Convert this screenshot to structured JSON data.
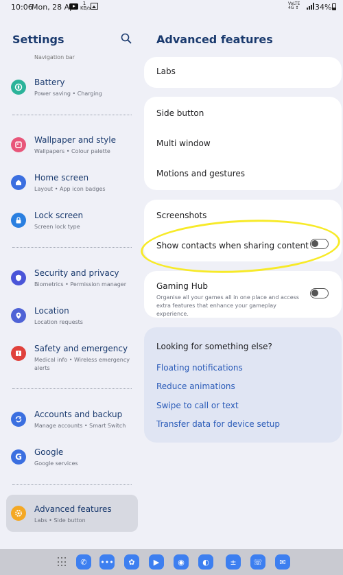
{
  "status_bar": {
    "time": "10:06",
    "date": "Mon, 28 Apr",
    "net_speed": "1\nKB/s",
    "network_label": "VoLTE 4G",
    "battery": "34%"
  },
  "left_panel": {
    "title": "Settings",
    "partial_item_subtitle": "Navigation bar",
    "items": [
      {
        "title": "Battery",
        "subtitle": "Power saving  •  Charging",
        "icon": "battery-icon",
        "color": "#2bb39a"
      },
      {
        "title": "Wallpaper and style",
        "subtitle": "Wallpapers  •  Colour palette",
        "icon": "wallpaper-icon",
        "color": "#e8567a"
      },
      {
        "title": "Home screen",
        "subtitle": "Layout  •  App icon badges",
        "icon": "home-icon",
        "color": "#3b6fe0"
      },
      {
        "title": "Lock screen",
        "subtitle": "Screen lock type",
        "icon": "lock-icon",
        "color": "#2a7fe0"
      },
      {
        "title": "Security and privacy",
        "subtitle": "Biometrics  •  Permission manager",
        "icon": "shield-icon",
        "color": "#4a55d8"
      },
      {
        "title": "Location",
        "subtitle": "Location requests",
        "icon": "location-icon",
        "color": "#4f63d6"
      },
      {
        "title": "Safety and emergency",
        "subtitle": "Medical info  •  Wireless emergency alerts",
        "icon": "emergency-icon",
        "color": "#e0413c"
      },
      {
        "title": "Accounts and backup",
        "subtitle": "Manage accounts  •  Smart Switch",
        "icon": "sync-icon",
        "color": "#3b6fe0"
      },
      {
        "title": "Google",
        "subtitle": "Google services",
        "icon": "google-icon",
        "color": "#3b6fe0"
      },
      {
        "title": "Advanced features",
        "subtitle": "Labs  •  Side button",
        "icon": "gear-plus-icon",
        "color": "#f4a824"
      }
    ]
  },
  "right_panel": {
    "title": "Advanced features",
    "labs": "Labs",
    "side_button": "Side button",
    "multi_window": "Multi window",
    "motions": "Motions and gestures",
    "screenshots": "Screenshots",
    "show_contacts": "Show contacts when sharing content",
    "gaming_hub": "Gaming Hub",
    "gaming_hub_desc": "Organise all your games all in one place and access extra features that enhance your gameplay experience.",
    "looking_title": "Looking for something else?",
    "links": [
      "Floating notifications",
      "Reduce animations",
      "Swipe to call or text",
      "Transfer data for device setup"
    ]
  },
  "toggles": {
    "show_contacts": "off",
    "gaming_hub": "off"
  },
  "taskbar": {
    "apps": [
      {
        "icon": "phone-icon",
        "color": "#3d7ff0"
      },
      {
        "icon": "messages-icon",
        "color": "#3d7ff0"
      },
      {
        "icon": "flower-icon",
        "color": "#3d7ff0"
      },
      {
        "icon": "play-store-icon",
        "color": "#3d7ff0"
      },
      {
        "icon": "camera-icon",
        "color": "#3d7ff0"
      },
      {
        "icon": "internet-icon",
        "color": "#3d7ff0"
      },
      {
        "icon": "calculator-icon",
        "color": "#3d7ff0"
      },
      {
        "icon": "whatsapp-icon",
        "color": "#3d7ff0"
      },
      {
        "icon": "mail-icon",
        "color": "#3d7ff0"
      }
    ]
  }
}
